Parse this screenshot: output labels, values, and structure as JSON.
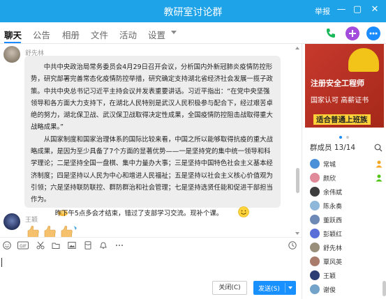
{
  "window": {
    "title": "教研室讨论群",
    "report_label": "举报",
    "minimize_glyph": "—",
    "maximize_glyph": "▢",
    "close_glyph": "✕"
  },
  "tabs": [
    {
      "label": "聊天",
      "active": true
    },
    {
      "label": "公告"
    },
    {
      "label": "相册"
    },
    {
      "label": "文件"
    },
    {
      "label": "活动"
    },
    {
      "label": "设置"
    }
  ],
  "header_actions": {
    "call_color": "#19b95a",
    "add_color": "#a34cdc",
    "more_color": "#1a8cff"
  },
  "messages": [
    {
      "sender": "舒先林",
      "paragraphs": [
        "中共中央政治局常务委员会4月29日召开会议，分析国内外新冠肺炎疫情防控形势，研究部署完善常态化疫情防控举措，研究确定支持湖北省经济社会发展一揽子政策。中共中央总书记习近平主持会议并发表重要讲话。习近平指出：“在党中央坚强领导和各方面大力支持下，在湖北人民特别是武汉人民积极参与配合下，经过艰苦卓绝的努力，湖北保卫战、武汉保卫战取得决定性成果，全国疫情防控阻击战取得重大战略成果。”",
        "从国家制度和国家治理体系的国际比较来看，中国之所以能够取得抗疫的重大战略成果，是因为至少具备了7个方面的显著优势——一是坚持党的集中统一领导和科学理论；二是坚持全国一盘棋、集中力量办大事；三是坚持中国特色社会主义基本经济制度；四是坚持以人民为中心和增进人民福祉；五是坚持以社会主义核心价值观为引领；六是坚持联防联控、群防群治和社会管理；七是坚持选贤任能和促进干部担当作为。"
      ],
      "closing_text": "昨下午5点多会才结束，错过了支部学习交流。现补个课。"
    },
    {
      "sender": "王颖"
    }
  ],
  "toolbar_icons": [
    "smile-icon",
    "gif-icon",
    "scissors-icon",
    "folder-icon",
    "image-icon",
    "red-packet-icon",
    "bell-icon",
    "more-icon",
    "history-icon"
  ],
  "input": {
    "close_label": "关闭(C)",
    "send_label": "发送(S)"
  },
  "ad": {
    "line1": "注册安全工程师",
    "line2": "国家认可 高薪证书",
    "line3": "适合普通上班族"
  },
  "members": {
    "header": "群成员 13/14",
    "list": [
      {
        "name": "常城",
        "avatar_color": "#4a90d9",
        "badge": "owner"
      },
      {
        "name": "颜欣",
        "avatar_color": "#e08a9a",
        "badge": "admin"
      },
      {
        "name": "余伟斌",
        "avatar_color": "#3d3d3d",
        "badge": "none"
      },
      {
        "name": "陈永奏",
        "avatar_color": "#8fb7d9",
        "badge": "none"
      },
      {
        "name": "董跃西",
        "avatar_color": "#6c8ab5",
        "badge": "none"
      },
      {
        "name": "彭颖红",
        "avatar_color": "#5b6fd8",
        "badge": "none"
      },
      {
        "name": "舒先林",
        "avatar_color": "#9a8f7b",
        "badge": "none"
      },
      {
        "name": "覃风英",
        "avatar_color": "#a97b6a",
        "badge": "none"
      },
      {
        "name": "王颖",
        "avatar_color": "#2c3e73",
        "badge": "none"
      },
      {
        "name": "谢俊",
        "avatar_color": "#74a3c9",
        "badge": "none"
      }
    ]
  }
}
